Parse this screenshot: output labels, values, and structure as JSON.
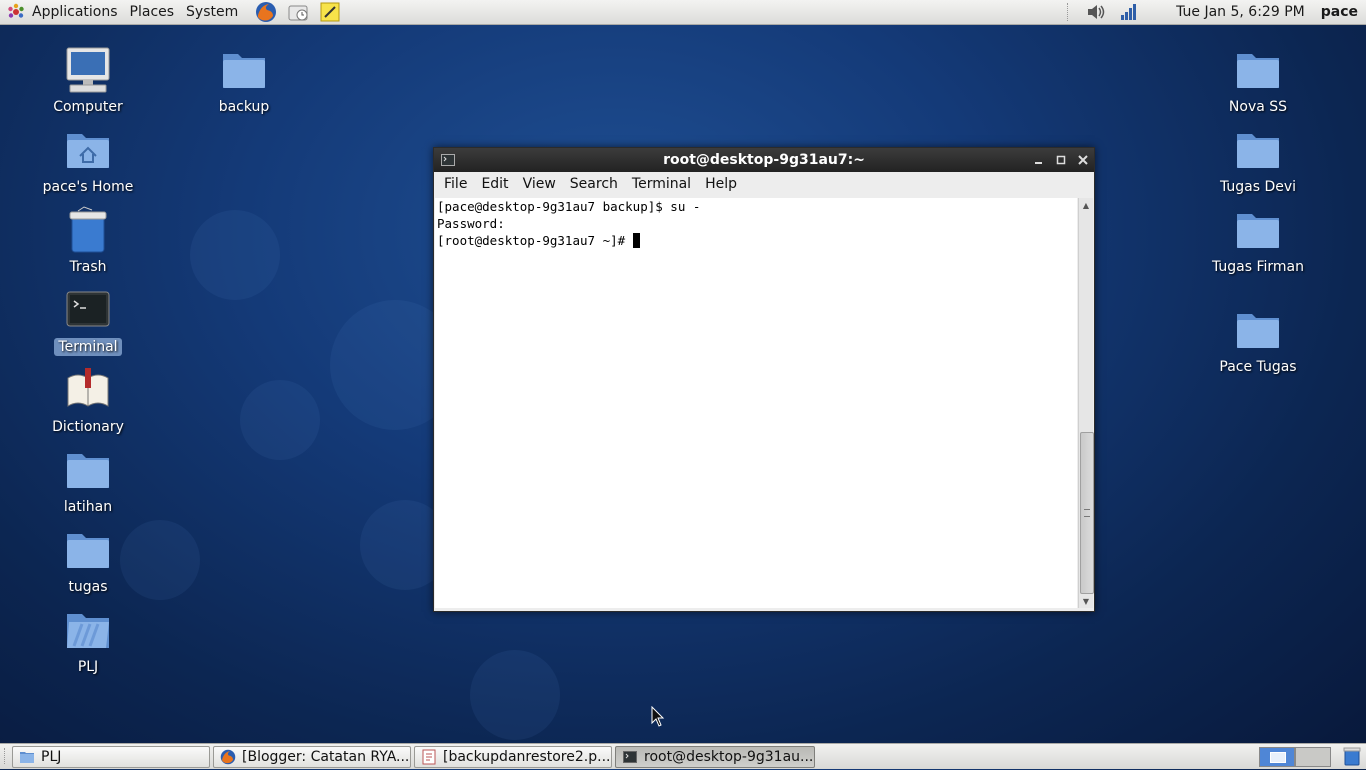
{
  "top_panel": {
    "menus": [
      "Applications",
      "Places",
      "System"
    ],
    "launchers": [
      "firefox-icon",
      "evolution-clock-icon",
      "notes-icon"
    ],
    "clock": "Tue Jan  5,  6:29 PM",
    "user": "pace"
  },
  "desktop": {
    "left_icons": [
      {
        "label": "Computer",
        "icon": "computer-icon"
      },
      {
        "label": "pace's Home",
        "icon": "home-folder-icon"
      },
      {
        "label": "Trash",
        "icon": "trash-icon"
      },
      {
        "label": "Terminal",
        "icon": "terminal-icon",
        "selected": true
      },
      {
        "label": "Dictionary",
        "icon": "dictionary-icon"
      },
      {
        "label": "latihan",
        "icon": "folder-icon"
      },
      {
        "label": "tugas",
        "icon": "folder-icon"
      },
      {
        "label": "PLJ",
        "icon": "folder-icon"
      }
    ],
    "second_column": [
      {
        "label": "backup",
        "icon": "folder-icon"
      }
    ],
    "right_icons": [
      {
        "label": "Nova SS",
        "icon": "folder-icon"
      },
      {
        "label": "Tugas Devi",
        "icon": "folder-icon"
      },
      {
        "label": "Tugas Firman",
        "icon": "folder-icon"
      },
      {
        "label": "Pace Tugas",
        "icon": "folder-icon"
      }
    ]
  },
  "terminal": {
    "title": "root@desktop-9g31au7:~",
    "menu": [
      "File",
      "Edit",
      "View",
      "Search",
      "Terminal",
      "Help"
    ],
    "lines": [
      "[pace@desktop-9g31au7 backup]$ su -",
      "Password:",
      "[root@desktop-9g31au7 ~]# "
    ]
  },
  "taskbar": {
    "items": [
      {
        "label": "PLJ",
        "icon": "folder-icon",
        "active": false
      },
      {
        "label": "[Blogger: Catatan RYA...",
        "icon": "firefox-icon",
        "active": false
      },
      {
        "label": "[backupdanrestore2.p...",
        "icon": "document-icon",
        "active": false
      },
      {
        "label": "root@desktop-9g31au...",
        "icon": "terminal-icon",
        "active": true
      }
    ]
  },
  "colors": {
    "desktop_bg": "#143a78",
    "folder_blue": "#6a9ad8",
    "selected_label": "#6f8fbd"
  }
}
